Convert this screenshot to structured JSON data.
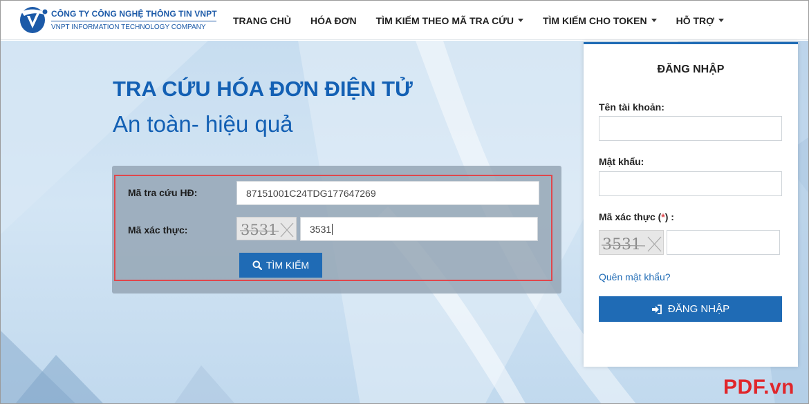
{
  "header": {
    "company_vn": "CÔNG TY CÔNG NGHỆ THÔNG TIN VNPT",
    "company_en": "VNPT INFORMATION TECHNOLOGY COMPANY",
    "nav": [
      {
        "label": "TRANG CHỦ",
        "dropdown": false
      },
      {
        "label": "HÓA ĐƠN",
        "dropdown": false
      },
      {
        "label": "TÌM KIẾM THEO MÃ TRA CỨU",
        "dropdown": true
      },
      {
        "label": "TÌM KIẾM CHO TOKEN",
        "dropdown": true
      },
      {
        "label": "HỖ TRỢ",
        "dropdown": true
      }
    ]
  },
  "hero": {
    "title": "TRA CỨU HÓA ĐƠN ĐIỆN TỬ",
    "subtitle": "An toàn- hiệu quả"
  },
  "search": {
    "code_label": "Mã tra cứu HĐ:",
    "code_value": "87151001C24TDG177647269",
    "captcha_label": "Mã xác thực:",
    "captcha_image_text": "3531",
    "captcha_value": "3531",
    "button_label": "TÌM KIẾM",
    "button_icon": "search-icon"
  },
  "login": {
    "title": "ĐĂNG NHẬP",
    "username_label": "Tên tài khoản:",
    "password_label": "Mật khẩu:",
    "captcha_label": "Mã xác thực (",
    "captcha_star": "*",
    "captcha_label_end": ") :",
    "captcha_image_text": "3531",
    "forgot_label": "Quên mật khẩu?",
    "button_label": "ĐĂNG NHẬP",
    "button_icon": "sign-in-icon"
  },
  "watermark": "PDF.vn",
  "colors": {
    "brand_blue": "#1f6bb5",
    "title_blue": "#1360b4",
    "highlight_red": "#e0464b",
    "watermark_red": "#e0262b"
  }
}
